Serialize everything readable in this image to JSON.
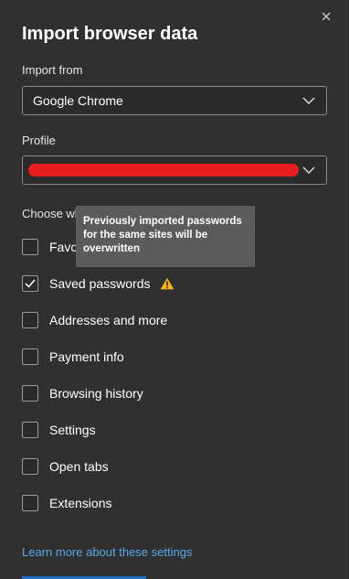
{
  "dialog": {
    "title": "Import browser data",
    "close_icon": "close-icon"
  },
  "import_from": {
    "label": "Import from",
    "value": "Google Chrome"
  },
  "profile": {
    "label": "Profile",
    "value": ""
  },
  "choose": {
    "label": "Choose wh"
  },
  "tooltip": {
    "text": "Previously imported passwords for the same sites will be overwritten"
  },
  "options": [
    {
      "label": "Favo",
      "checked": false
    },
    {
      "label": "Saved passwords",
      "checked": true
    },
    {
      "label": "Addresses and more",
      "checked": false
    },
    {
      "label": "Payment info",
      "checked": false
    },
    {
      "label": "Browsing history",
      "checked": false
    },
    {
      "label": "Settings",
      "checked": false
    },
    {
      "label": "Open tabs",
      "checked": false
    },
    {
      "label": "Extensions",
      "checked": false
    }
  ],
  "footer": {
    "learn_more": "Learn more about these settings"
  },
  "colors": {
    "background": "#303030",
    "accent_link": "#5aa9e6",
    "warning": "#f2b61a",
    "redaction": "#e81d1d"
  }
}
